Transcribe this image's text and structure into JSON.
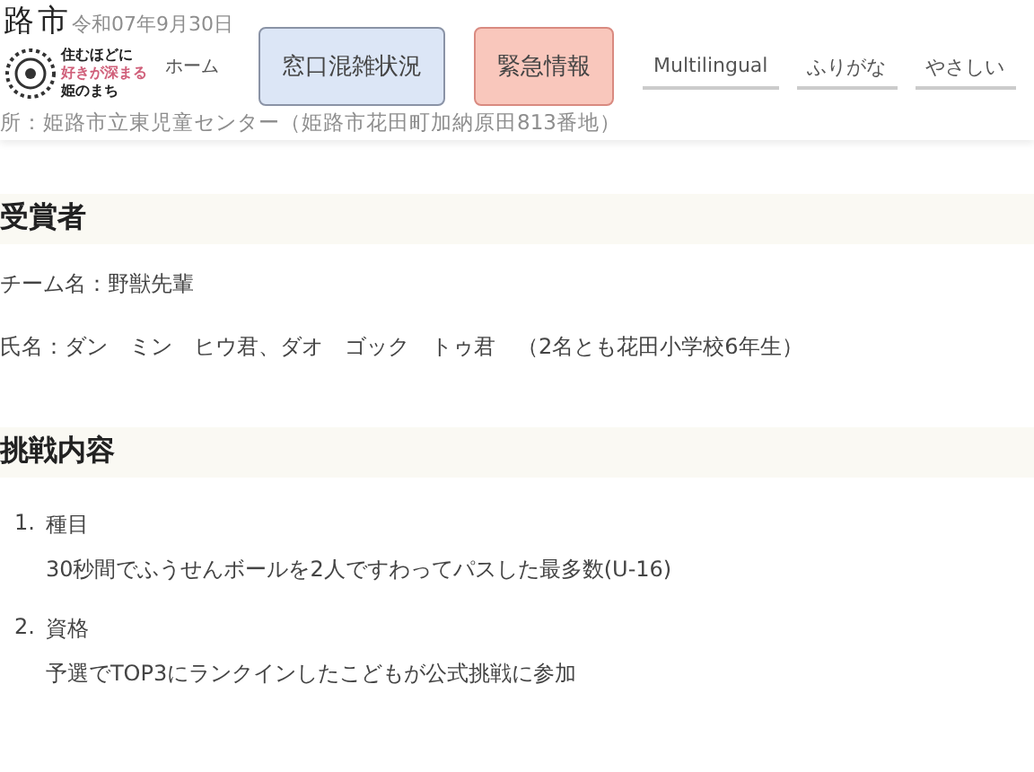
{
  "header": {
    "logo_title": "路市",
    "logo_slogan": [
      "住むほどに",
      "好きが深まる",
      "姫のまち"
    ],
    "home_link": "ホーム",
    "behind_texts": [
      "令和07年9月30日",
      "所：姫路市立東児童センター（姫路市花田町加納原田813番地）"
    ],
    "buttons": [
      {
        "label": "窓口混雑状況",
        "kind": "congestion"
      },
      {
        "label": "緊急情報",
        "kind": "emergency"
      }
    ],
    "links": [
      "Multilingual",
      "ふりがな",
      "やさしい"
    ]
  },
  "sections": [
    {
      "heading": "受賞者",
      "paragraphs": [
        "チーム名：野獣先輩",
        "氏名：ダン　ミン　ヒウ君、ダオ　ゴック　トゥ君　（2名とも花田小学校6年生）"
      ]
    },
    {
      "heading": "挑戦内容",
      "items": [
        {
          "number": "1.",
          "title": "種目",
          "detail": "30秒間でふうせんボールを2人ですわってパスした最多数(U-16)"
        },
        {
          "number": "2.",
          "title": "資格",
          "detail": "予選でTOP3にランクインしたこどもが公式挑戦に参加"
        }
      ]
    }
  ]
}
